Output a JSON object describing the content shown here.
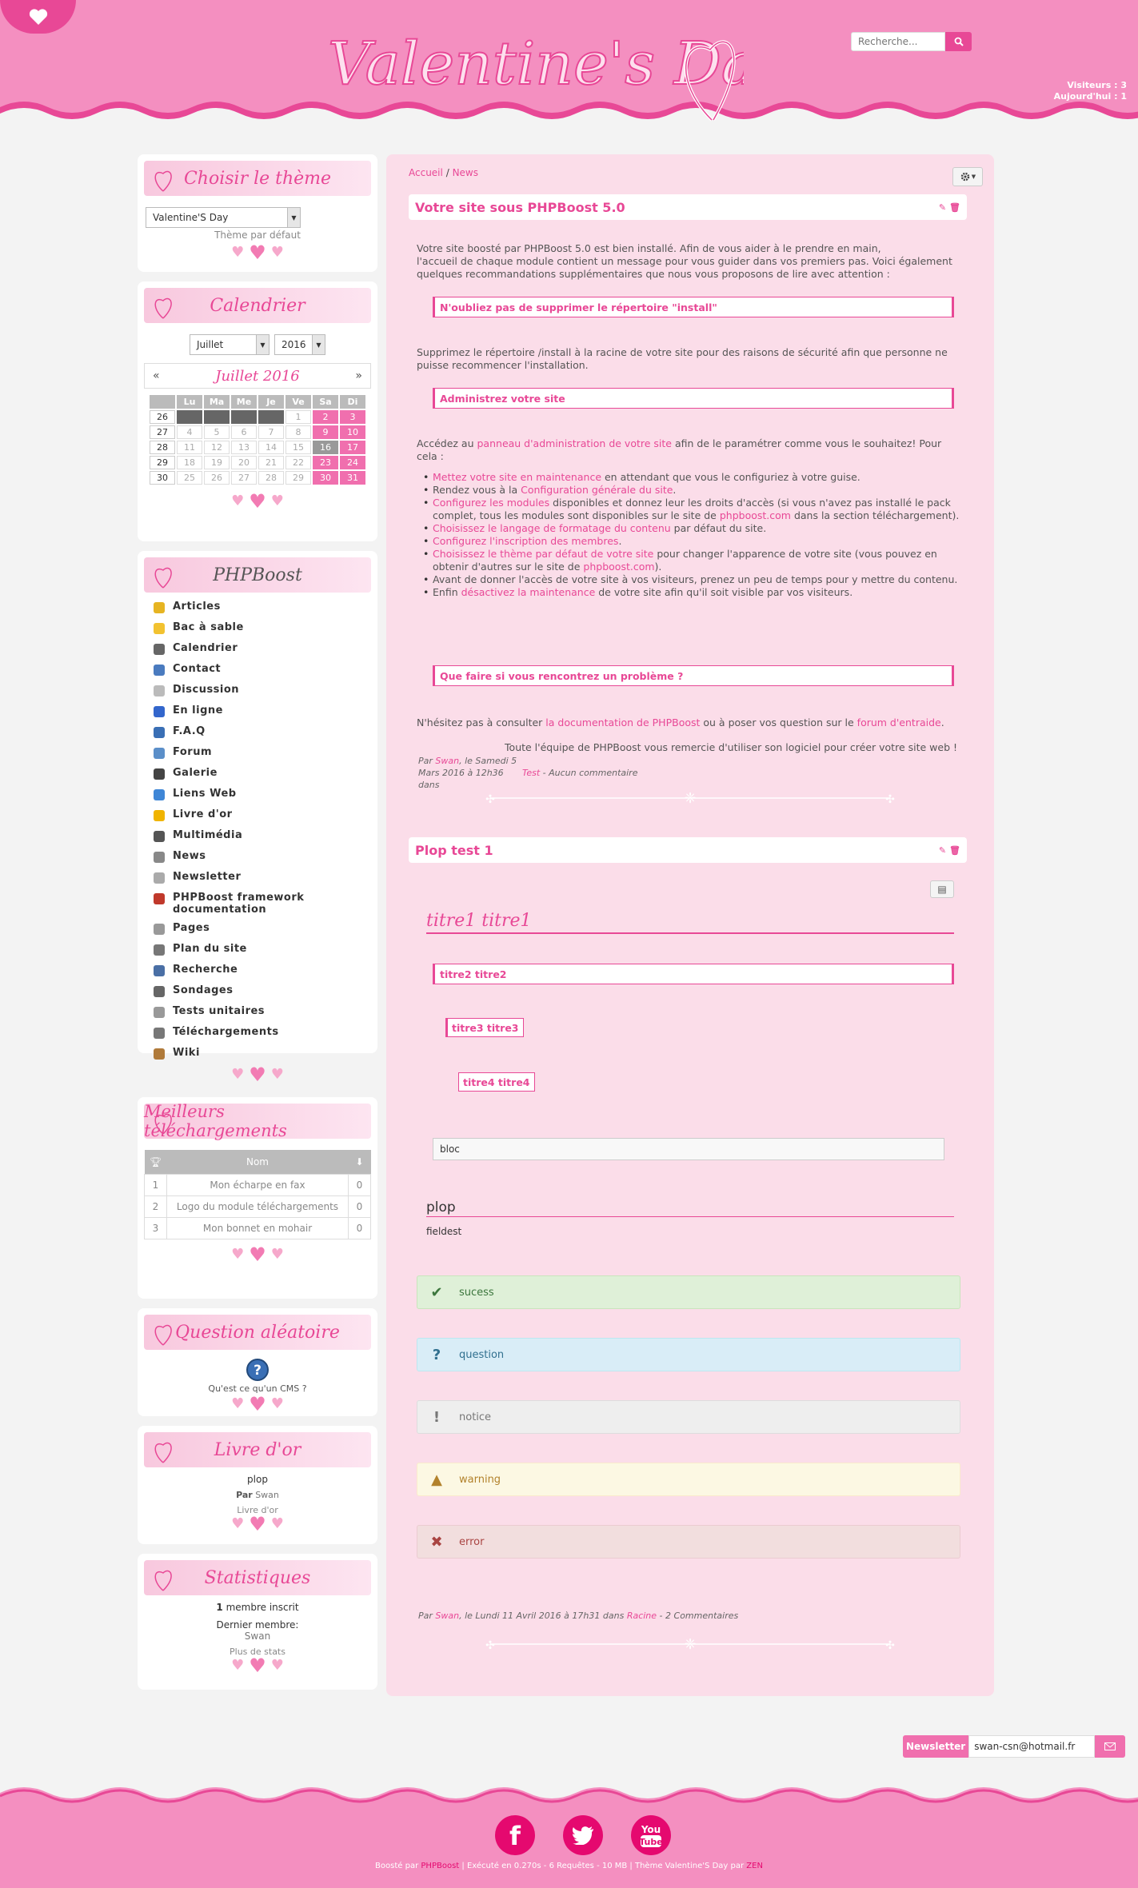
{
  "header": {
    "search_placeholder": "Recherche...",
    "visitors_label": "Visiteurs :",
    "visitors_count": "3",
    "today_label": "Aujourd'hui :",
    "today_count": "1"
  },
  "theme_menu": {
    "title": "Choisir le thème",
    "selected": "Valentine'S Day",
    "default_link": "Thème par défaut"
  },
  "calendar": {
    "title": "Calendrier",
    "month_select": "Juillet",
    "year_select": "2016",
    "prev": "«",
    "next": "»",
    "month_label": "Juillet 2016",
    "days": [
      "",
      "Lu",
      "Ma",
      "Me",
      "Je",
      "Ve",
      "Sa",
      "Di"
    ],
    "weeks": [
      {
        "n": "26",
        "d": [
          "",
          "",
          "",
          "",
          "1",
          "2",
          "3"
        ]
      },
      {
        "n": "27",
        "d": [
          "4",
          "5",
          "6",
          "7",
          "8",
          "9",
          "10"
        ]
      },
      {
        "n": "28",
        "d": [
          "11",
          "12",
          "13",
          "14",
          "15",
          "16",
          "17"
        ]
      },
      {
        "n": "29",
        "d": [
          "18",
          "19",
          "20",
          "21",
          "22",
          "23",
          "24"
        ]
      },
      {
        "n": "30",
        "d": [
          "25",
          "26",
          "27",
          "28",
          "29",
          "30",
          "31"
        ]
      }
    ],
    "today": "16"
  },
  "phpboost_menu": {
    "title": "PHPBoost",
    "links": [
      {
        "label": "Articles",
        "icon": "articles-icon",
        "color": "#e6b422"
      },
      {
        "label": "Bac à sable",
        "icon": "sandbox-icon",
        "color": "#f2c230"
      },
      {
        "label": "Calendrier",
        "icon": "calendar-icon",
        "color": "#666666"
      },
      {
        "label": "Contact",
        "icon": "contact-icon",
        "color": "#4a7bbf"
      },
      {
        "label": "Discussion",
        "icon": "discussion-icon",
        "color": "#bbbbbb"
      },
      {
        "label": "En ligne",
        "icon": "online-icon",
        "color": "#3366cc"
      },
      {
        "label": "F.A.Q",
        "icon": "faq-icon",
        "color": "#3a6fb5"
      },
      {
        "label": "Forum",
        "icon": "forum-icon",
        "color": "#5b8fc9"
      },
      {
        "label": "Galerie",
        "icon": "gallery-icon",
        "color": "#444444"
      },
      {
        "label": "Liens Web",
        "icon": "weblinks-icon",
        "color": "#3f86d6"
      },
      {
        "label": "Livre d'or",
        "icon": "guestbook-icon",
        "color": "#f0b400"
      },
      {
        "label": "Multimédia",
        "icon": "multimedia-icon",
        "color": "#555555"
      },
      {
        "label": "News",
        "icon": "news-icon",
        "color": "#888888"
      },
      {
        "label": "Newsletter",
        "icon": "newsletter-icon",
        "color": "#aaaaaa"
      },
      {
        "label": "PHPBoost framework documentation",
        "icon": "doc-icon",
        "color": "#c0392b"
      },
      {
        "label": "Pages",
        "icon": "pages-icon",
        "color": "#999999"
      },
      {
        "label": "Plan du site",
        "icon": "sitemap-icon",
        "color": "#777777"
      },
      {
        "label": "Recherche",
        "icon": "search-icon",
        "color": "#4a6fa5"
      },
      {
        "label": "Sondages",
        "icon": "poll-icon",
        "color": "#666666"
      },
      {
        "label": "Tests unitaires",
        "icon": "unittest-icon",
        "color": "#999999"
      },
      {
        "label": "Téléchargements",
        "icon": "download-icon",
        "color": "#777777"
      },
      {
        "label": "Wiki",
        "icon": "wiki-icon",
        "color": "#b07a3a"
      }
    ]
  },
  "downloads_menu": {
    "title": "Meilleurs téléchargements",
    "col_name": "Nom",
    "rows": [
      {
        "rank": "1",
        "name": "Mon écharpe en fax",
        "count": "0"
      },
      {
        "rank": "2",
        "name": "Logo du module téléchargements",
        "count": "0"
      },
      {
        "rank": "3",
        "name": "Mon bonnet en mohair",
        "count": "0"
      }
    ]
  },
  "question_menu": {
    "title": "Question aléatoire",
    "question": "Qu'est ce qu'un CMS ?"
  },
  "guestbook_menu": {
    "title": "Livre d'or",
    "message": "plop",
    "by": "Par",
    "author": "Swan",
    "link": "Livre d'or"
  },
  "stats_menu": {
    "title": "Statistiques",
    "members_count": "1",
    "members_label": "membre inscrit",
    "last_member_label": "Dernier membre:",
    "last_member": "Swan",
    "more_link": "Plus de stats"
  },
  "breadcrumb": {
    "home": "Accueil",
    "sep": "/",
    "current": "News"
  },
  "article1": {
    "title": "Votre site sous PHPBoost 5.0",
    "intro1": "Votre site boosté par PHPBoost 5.0 est bien installé. Afin de vous aider à le prendre en main,",
    "intro2": "l'accueil de chaque module contient un message pour vous guider dans vos premiers pas. Voici également quelques recommandations supplémentaires que nous vous proposons de lire avec attention :",
    "h_install": "N'oubliez pas de supprimer le répertoire \"install\"",
    "install_text": "Supprimez le répertoire /install à la racine de votre site pour des raisons de sécurité afin que personne ne puisse recommencer l'installation.",
    "h_admin": "Administrez votre site",
    "admin_pre": "Accédez au",
    "admin_link": "panneau d'administration de votre site",
    "admin_post": "afin de le paramétrer comme vous le souhaitez! Pour cela :",
    "steps": [
      {
        "link": "Mettez votre site en maintenance",
        "text": " en attendant que vous le configuriez à votre guise."
      },
      {
        "pre": "Rendez vous à la ",
        "link": "Configuration générale du site",
        "text": "."
      },
      {
        "link": "Configurez les modules",
        "text": " disponibles et donnez leur les droits d'accès (si vous n'avez pas installé le pack complet, tous les modules sont disponibles sur le site de ",
        "link2": "phpboost.com",
        "text2": " dans la section téléchargement)."
      },
      {
        "link": "Choisissez le langage de formatage du contenu",
        "text": " par défaut du site."
      },
      {
        "link": "Configurez l'inscription des membres",
        "text": "."
      },
      {
        "link": "Choisissez le thème par défaut de votre site",
        "text": " pour changer l'apparence de votre site (vous pouvez en obtenir d'autres sur le site de ",
        "link2": "phpboost.com",
        "text2": ")."
      },
      {
        "pre": "Avant de donner l'accès de votre site à vos visiteurs, prenez un peu de temps pour y mettre du contenu."
      },
      {
        "pre": "Enfin ",
        "link": "désactivez la maintenance",
        "text": " de votre site afin qu'il soit visible par vos visiteurs."
      }
    ],
    "h_problem": "Que faire si vous rencontrez un problème ?",
    "problem_pre": "N'hésitez pas à consulter",
    "problem_link1": "la documentation de PHPBoost",
    "problem_mid": "ou à poser vos question sur le",
    "problem_link2": "forum d'entraide",
    "thanks": "Toute l'équipe de PHPBoost vous remercie d'utiliser son logiciel pour créer votre site web !",
    "info_by": "Par",
    "info_author": "Swan",
    "info_date": ", le Samedi 5 Mars 2016 à 12h36 dans",
    "info_cat": "Test",
    "info_comments": "- Aucun commentaire"
  },
  "article2": {
    "title": "Plop test 1",
    "h1": "titre1 titre1",
    "h2": "titre2 titre2",
    "h3": "titre3 titre3",
    "h4": "titre4 titre4",
    "bloc": "bloc",
    "fieldset_legend": "plop",
    "fieldset_text": "fieldest",
    "alerts": [
      {
        "type": "success",
        "text": "sucess",
        "bg": "#dff0d8",
        "border": "#c8e5bc",
        "fg": "#3c763d",
        "icon": "check-icon",
        "glyph": "✔"
      },
      {
        "type": "question",
        "text": "question",
        "bg": "#d9edf7",
        "border": "#bce8f1",
        "fg": "#31708f",
        "icon": "question-icon",
        "glyph": "?"
      },
      {
        "type": "notice",
        "text": "notice",
        "bg": "#eeeeee",
        "border": "#dddddd",
        "fg": "#777777",
        "icon": "exclamation-icon",
        "glyph": "!"
      },
      {
        "type": "warning",
        "text": "warning",
        "bg": "#fcf8e3",
        "border": "#faebcc",
        "fg": "#b2822c",
        "icon": "warning-icon",
        "glyph": "▲"
      },
      {
        "type": "error",
        "text": "error",
        "bg": "#f2dede",
        "border": "#ebccd1",
        "fg": "#a94442",
        "icon": "error-icon",
        "glyph": "✖"
      }
    ],
    "info_by": "Par",
    "info_author": "Swan",
    "info_date": ", le Lundi 11 Avril 2016 à 17h31 dans",
    "info_cat": "Racine",
    "info_comments": "- 2 Commentaires"
  },
  "newsletter": {
    "label": "Newsletter",
    "email": "swan-csn@hotmail.fr"
  },
  "footer": {
    "boosted_by": "Boosté par",
    "phpboost": "PHPBoost",
    "exec": "|  Exécuté en 0.270s - 6 Requêtes - 10 MB | Thème Valentine'S Day par",
    "author": "ZEN"
  }
}
